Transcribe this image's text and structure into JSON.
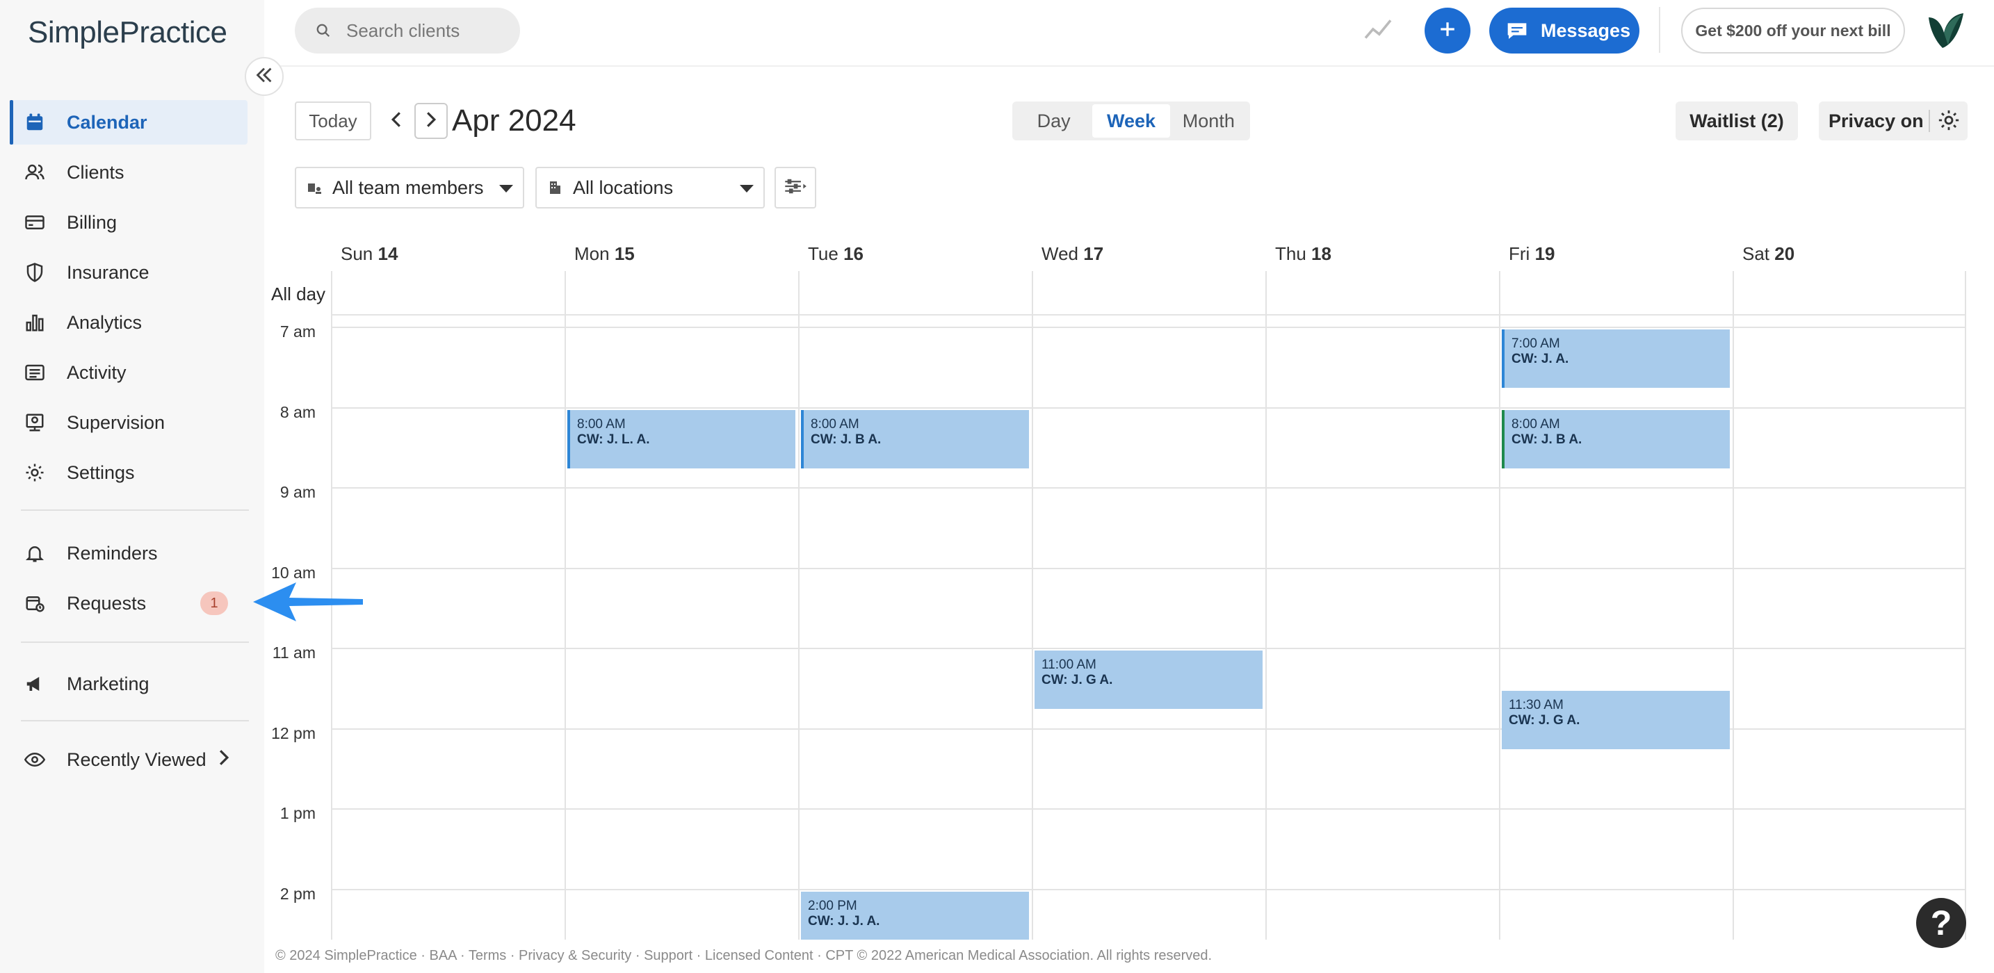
{
  "app": {
    "logo_text": "SimplePractice"
  },
  "sidebar": {
    "items": [
      {
        "label": "Calendar",
        "icon": "calendar-icon",
        "active": true
      },
      {
        "label": "Clients",
        "icon": "clients-icon"
      },
      {
        "label": "Billing",
        "icon": "credit-card-icon"
      },
      {
        "label": "Insurance",
        "icon": "shield-icon"
      },
      {
        "label": "Analytics",
        "icon": "bar-chart-icon"
      },
      {
        "label": "Activity",
        "icon": "list-icon"
      },
      {
        "label": "Supervision",
        "icon": "supervision-icon"
      },
      {
        "label": "Settings",
        "icon": "gear-icon"
      }
    ],
    "secondary": [
      {
        "label": "Reminders",
        "icon": "bell-icon"
      },
      {
        "label": "Requests",
        "icon": "calendar-request-icon",
        "badge": "1"
      }
    ],
    "marketing": {
      "label": "Marketing",
      "icon": "megaphone-icon"
    },
    "recent": {
      "label": "Recently Viewed",
      "icon": "eye-icon"
    }
  },
  "topbar": {
    "search_placeholder": "Search clients",
    "messages_label": "Messages",
    "promo_label": "Get $200 off your next bill"
  },
  "toolbar": {
    "today_label": "Today",
    "period_title": "Apr 2024",
    "views": [
      "Day",
      "Week",
      "Month"
    ],
    "selected_view": "Week",
    "waitlist_label": "Waitlist (2)",
    "privacy_label": "Privacy on",
    "team_filter": "All team members",
    "location_filter": "All locations"
  },
  "calendar": {
    "days": [
      {
        "name": "Sun",
        "num": "14"
      },
      {
        "name": "Mon",
        "num": "15"
      },
      {
        "name": "Tue",
        "num": "16"
      },
      {
        "name": "Wed",
        "num": "17"
      },
      {
        "name": "Thu",
        "num": "18"
      },
      {
        "name": "Fri",
        "num": "19"
      },
      {
        "name": "Sat",
        "num": "20"
      }
    ],
    "allday_label": "All day",
    "hours": [
      "7 am",
      "8 am",
      "9 am",
      "10 am",
      "11 am",
      "12 pm",
      "1 pm",
      "2 pm"
    ],
    "events": [
      {
        "day": 5,
        "start": "7:00 AM",
        "who": "CW: J. A.",
        "start_hour": 7.0,
        "edge": "blue"
      },
      {
        "day": 1,
        "start": "8:00 AM",
        "who": "CW: J. L. A.",
        "start_hour": 8.0,
        "edge": "blue"
      },
      {
        "day": 2,
        "start": "8:00 AM",
        "who": "CW: J. B A.",
        "start_hour": 8.0,
        "edge": "blue"
      },
      {
        "day": 5,
        "start": "8:00 AM",
        "who": "CW: J. B A.",
        "start_hour": 8.0,
        "edge": "green"
      },
      {
        "day": 3,
        "start": "11:00 AM",
        "who": "CW: J. G A.",
        "start_hour": 11.0,
        "edge": "none"
      },
      {
        "day": 5,
        "start": "11:30 AM",
        "who": "CW: J. G A.",
        "start_hour": 11.5,
        "edge": "none"
      },
      {
        "day": 2,
        "start": "2:00 PM",
        "who": "CW: J. J. A.",
        "start_hour": 14.0,
        "edge": "none"
      }
    ]
  },
  "footer": {
    "text": "© 2024 SimplePractice · BAA · Terms · Privacy & Security · Support · Licensed Content · CPT © 2022 American Medical Association. All rights reserved."
  },
  "help": {
    "label": "?"
  },
  "colors": {
    "accent": "#1c6cd2",
    "event_bg": "#a8cbeb",
    "active_nav_bg": "#e6eef8"
  }
}
